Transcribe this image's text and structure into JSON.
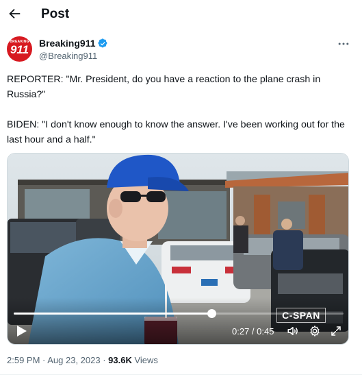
{
  "header": {
    "title": "Post"
  },
  "author": {
    "display_name": "Breaking911",
    "handle": "@Breaking911",
    "avatar_text_small": "BREAKING",
    "avatar_text_big": "911",
    "verified": true,
    "accent_color": "#1d9bf0",
    "avatar_color": "#d71920"
  },
  "tweet": {
    "paragraph_1": "REPORTER: \"Mr. President, do you have a reaction to the plane crash in Russia?\"",
    "paragraph_2": "BIDEN: \"I don't know enough to know the answer. I've been working out for the last hour and a half.\""
  },
  "video": {
    "watermark": "C-SPAN",
    "current_time": "0:27 / 0:45",
    "progress_fraction": 0.6
  },
  "meta": {
    "timestamp": "2:59 PM · Aug 23, 2023 · ",
    "views_count": "93.6K",
    "views_label": " Views"
  },
  "icons": {
    "back": "arrow-left-icon",
    "more": "more-dots-icon",
    "verified": "verified-badge-icon",
    "play": "play-icon",
    "volume": "volume-icon",
    "settings": "gear-icon",
    "fullscreen": "fullscreen-icon"
  }
}
